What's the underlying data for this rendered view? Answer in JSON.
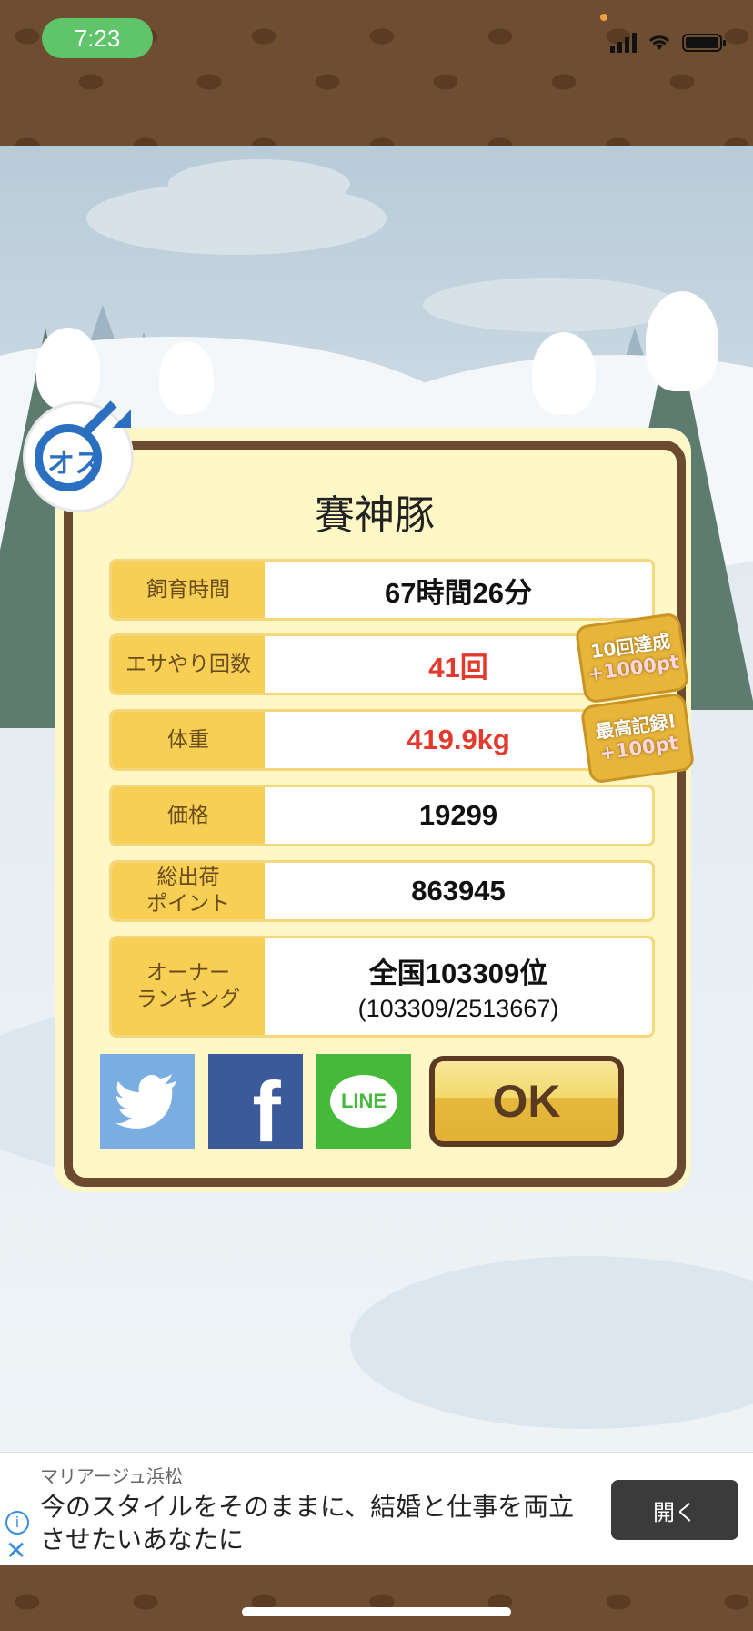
{
  "status_bar": {
    "time": "7:23"
  },
  "pig": {
    "name": "賽神豚",
    "sex_label": "オス"
  },
  "stats": [
    {
      "label": "飼育時間",
      "value": "67時間26分",
      "highlight": false
    },
    {
      "label": "エサやり回数",
      "value": "41回",
      "highlight": true
    },
    {
      "label": "体重",
      "value": "419.9kg",
      "highlight": true
    },
    {
      "label": "価格",
      "value": "19299",
      "highlight": false
    },
    {
      "label": "総出荷\nポイント",
      "value": "863945",
      "highlight": false
    }
  ],
  "ranking": {
    "label": "オーナー\nランキング",
    "value": "全国103309位",
    "detail": "(103309/2513667)"
  },
  "achievements": [
    {
      "title": "10回達成",
      "points": "+1000pt"
    },
    {
      "title": "最高記録!",
      "points": "+100pt"
    }
  ],
  "buttons": {
    "line_label": "LINE",
    "ok_label": "OK"
  },
  "ad": {
    "advertiser": "マリアージュ浜松",
    "headline": "今のスタイルをそのままに、結婚と仕事を両立させたいあなたに",
    "open_label": "開く"
  },
  "colors": {
    "panel_border": "#6b4a30",
    "label_bg": "#f7cf55",
    "highlight_text": "#e23a2c",
    "twitter": "#7aaee2",
    "facebook": "#3b5a9a",
    "line": "#45b93a"
  }
}
